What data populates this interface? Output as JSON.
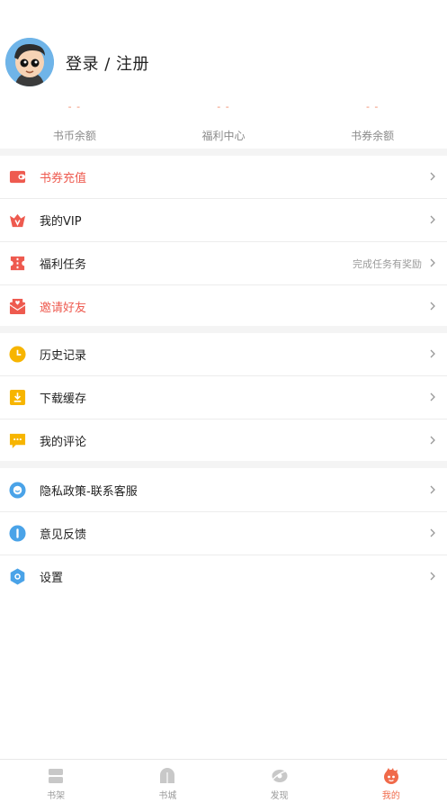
{
  "profile": {
    "login_label": "登录 / 注册"
  },
  "stats": [
    {
      "value": "- -",
      "label": "书币余额"
    },
    {
      "value": "- -",
      "label": "福利中心"
    },
    {
      "value": "- -",
      "label": "书券余额"
    }
  ],
  "group1": [
    {
      "label": "书券充值",
      "icon": "wallet-icon",
      "highlight": true
    },
    {
      "label": "我的VIP",
      "icon": "vip-crown-icon",
      "highlight": false
    },
    {
      "label": "福利任务",
      "icon": "ticket-icon",
      "highlight": false,
      "hint": "完成任务有奖励"
    },
    {
      "label": "邀请好友",
      "icon": "envelope-heart-icon",
      "highlight": true
    }
  ],
  "group2": [
    {
      "label": "历史记录",
      "icon": "clock-icon"
    },
    {
      "label": "下载缓存",
      "icon": "download-icon"
    },
    {
      "label": "我的评论",
      "icon": "comment-icon"
    }
  ],
  "group3": [
    {
      "label": "隐私政策-联系客服",
      "icon": "customer-service-icon"
    },
    {
      "label": "意见反馈",
      "icon": "feedback-icon"
    },
    {
      "label": "设置",
      "icon": "settings-icon"
    }
  ],
  "tabs": [
    {
      "label": "书架",
      "icon": "bookshelf-icon",
      "active": false
    },
    {
      "label": "书城",
      "icon": "bookstore-icon",
      "active": false
    },
    {
      "label": "发现",
      "icon": "discover-icon",
      "active": false
    },
    {
      "label": "我的",
      "icon": "mine-icon",
      "active": true
    }
  ],
  "colors": {
    "accent": "#f06a4a",
    "highlight_text": "#ee5a4f",
    "stat_value": "#f08a6a",
    "divider": "#f4f4f4"
  }
}
